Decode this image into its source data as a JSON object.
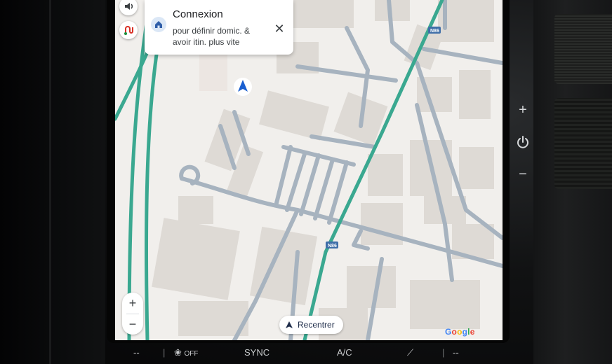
{
  "notification": {
    "title": "Connexion",
    "body": "pour définir domic. & avoir itin. plus vite",
    "icon": "home-icon",
    "close_icon": "close-icon"
  },
  "map": {
    "road_labels": [
      "N86",
      "N86"
    ],
    "position_marker": "navigation-arrow-icon",
    "attribution": "Google",
    "recenter_label": "Recentrer",
    "zoom_in": "+",
    "zoom_out": "−"
  },
  "side_buttons": {
    "volume_icon": "volume-icon",
    "routes_icon": "alternate-routes-icon"
  },
  "hardware": {
    "plus": "+",
    "power_icon": "power-icon",
    "minus": "−"
  },
  "climate_bar": {
    "left_temp": "--",
    "fan_off": "OFF",
    "sync": "SYNC",
    "ac": "A/C",
    "right_temp": "--"
  },
  "colors": {
    "highway": "#3aa890",
    "road": "#a7b3bf",
    "building": "#dedad5",
    "map_bg": "#f1efec",
    "accent": "#1a73e8"
  }
}
